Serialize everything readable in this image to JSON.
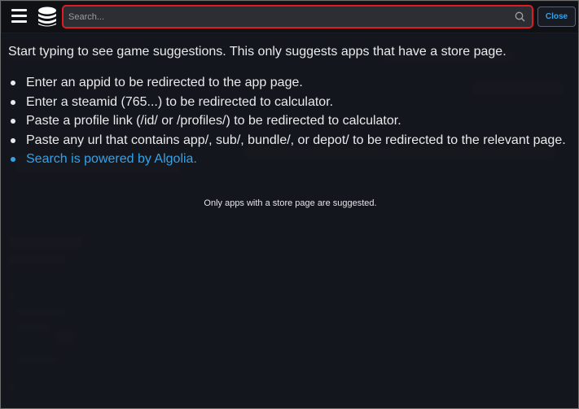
{
  "topbar": {
    "search": {
      "placeholder": "Search...",
      "value": ""
    },
    "close_label": "Close",
    "icons": {
      "menu": "hamburger-menu-icon",
      "logo": "steamdb-logo-icon",
      "search": "magnifier-icon"
    }
  },
  "content": {
    "intro": "Start typing to see game suggestions. This only suggests apps that have a store page.",
    "tips": [
      "Enter an appid to be redirected to the app page.",
      "Enter a steamid (765...) to be redirected to calculator.",
      "Paste a profile link (/id/ or /profiles/) to be redirected to calculator.",
      "Paste any url that contains app/, sub/, bundle/, or depot/ to be redirected to the relevant page."
    ],
    "algolia_link": "Search is powered by Algolia.",
    "note": "Only apps with a store page are suggested."
  },
  "colors": {
    "accent": "#35a2e8",
    "search_border": "#e11b22",
    "background": "#1a1d23",
    "topbar": "#101114"
  }
}
